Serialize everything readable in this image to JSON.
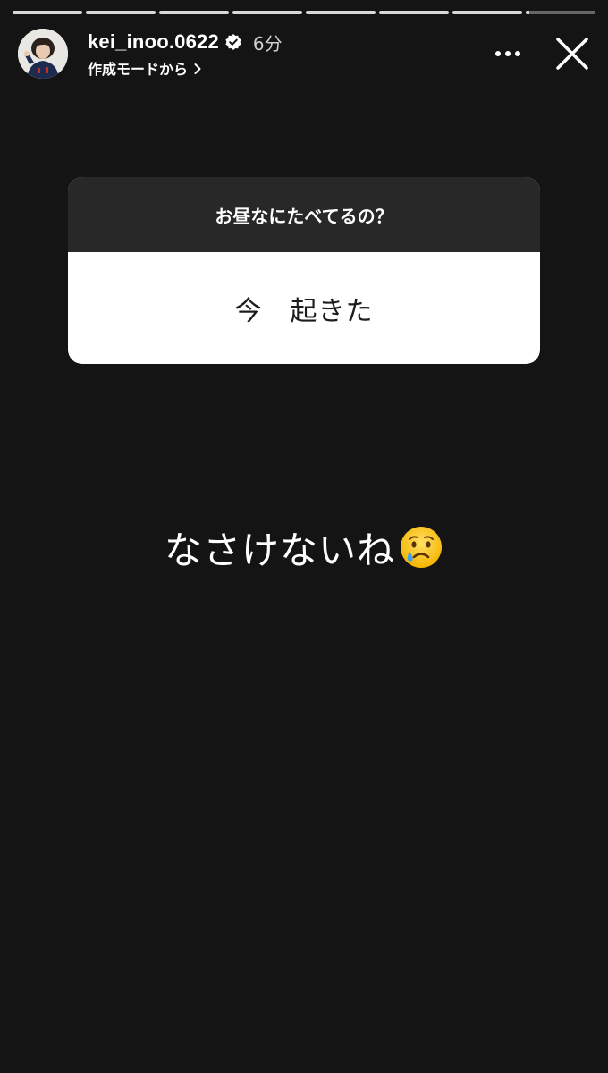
{
  "story": {
    "segment_count": 8,
    "current_segment_progress": 0.05
  },
  "header": {
    "username": "kei_inoo.0622",
    "verified": true,
    "time_ago": "6分",
    "subline": "作成モードから",
    "avatar_icon": "profile-photo",
    "more_icon": "more-horizontal-icon",
    "close_icon": "close-icon"
  },
  "question_card": {
    "question": "お昼なにたべてるの？",
    "answer": "今　起きた"
  },
  "caption": {
    "text": "なさけないね",
    "emoji_icon": "crying-face-icon"
  },
  "colors": {
    "background": "#141414",
    "card_header": "#282828",
    "card_body": "#ffffff",
    "progress": "#d8d8d8"
  }
}
